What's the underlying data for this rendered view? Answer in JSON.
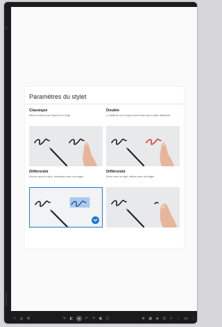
{
  "dialog": {
    "title": "Paramètres du stylet"
  },
  "options": [
    {
      "name": "Classique",
      "description": "Même écriture pour Stylet fin et doigt.",
      "selected": false
    },
    {
      "name": "Double",
      "description": "Le stylet fin et le doigt écrivent dans deux styles différents.",
      "selected": false
    },
    {
      "name": "Différentié",
      "description": "Écrivez avec un stylo, choisissez avec vos doigts.",
      "selected": true
    },
    {
      "name": "Différentié",
      "description": "Écrire avec un stylo, effacer avec les doigts.",
      "selected": false
    }
  ],
  "toolbar": {
    "page": "1/1",
    "left_icons": [
      "close-icon",
      "share-icon",
      "settings-icon"
    ],
    "center_icons": [
      "pen-icon",
      "eraser-icon",
      "selector-icon",
      "undo-icon",
      "redo-icon",
      "image-icon",
      "shapes-icon"
    ],
    "right_icons": [
      "zoom-icon",
      "grid-icon",
      "layers-icon",
      "save-icon",
      "add-page-icon",
      "prev-page-icon",
      "next-page-icon"
    ]
  },
  "colors": {
    "accent": "#1e78d4",
    "second_stroke": "#d83a3a",
    "highlight": "#a9c9ee"
  }
}
